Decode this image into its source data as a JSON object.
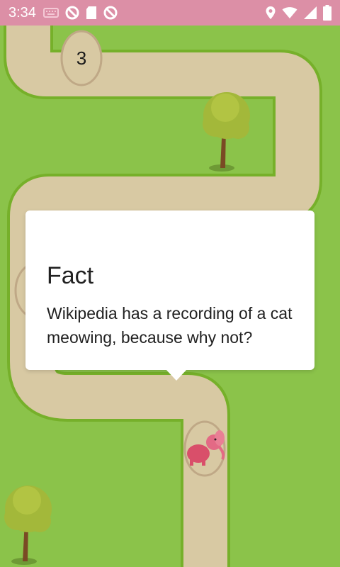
{
  "status_bar": {
    "time": "3:34",
    "left_icons": [
      "keyboard-icon",
      "notification-blocked-icon",
      "sd-card-icon",
      "notification-blocked-icon"
    ],
    "right_icons": [
      "location-icon",
      "wifi-icon",
      "signal-icon",
      "battery-icon"
    ],
    "color": "#dc8fa6"
  },
  "map": {
    "level_node_number": "3",
    "grass_color": "#8bc34a",
    "path_color": "#d8c9a3"
  },
  "fact_dialog": {
    "title": "Fact",
    "text": "Wikipedia has a recording of a cat meowing, because why not?"
  }
}
